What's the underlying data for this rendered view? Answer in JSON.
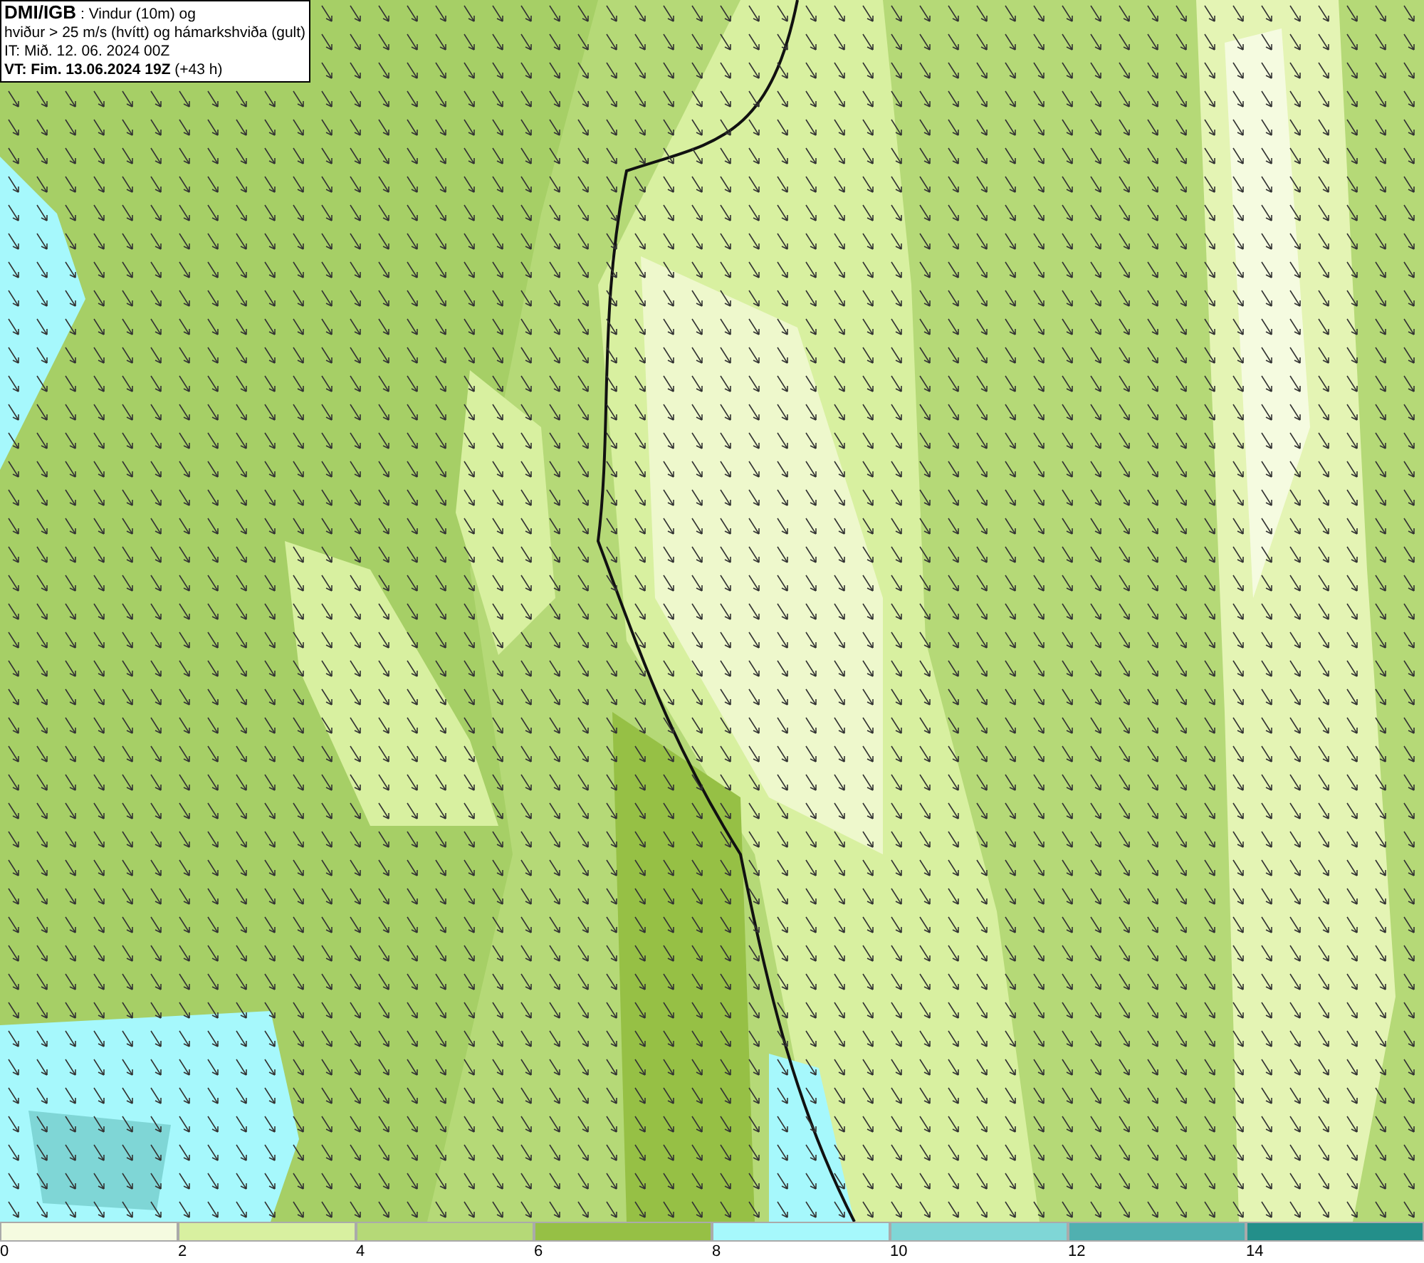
{
  "header": {
    "title": "**DMI/IGB** : Vindur (10m) og",
    "lines": [
      "hviður > 25 m/s (hvítt) og hámarkshviða (gult)",
      "IT: Mið. 12. 06. 2024 00Z",
      "**VT: Fim. 13.06.2024 19Z** (+43 h)"
    ]
  },
  "legend": [
    {
      "label": "0",
      "color": "#f5fbe0"
    },
    {
      "label": "2",
      "color": "#d8f0a0"
    },
    {
      "label": "4",
      "color": "#b5d977"
    },
    {
      "label": "6",
      "color": "#96c045"
    },
    {
      "label": "8",
      "color": "#a6f8fc"
    },
    {
      "label": "10",
      "color": "#7fd6d6"
    },
    {
      "label": "12",
      "color": "#50b0b0"
    },
    {
      "label": "14",
      "color": "#238f8a"
    }
  ]
}
